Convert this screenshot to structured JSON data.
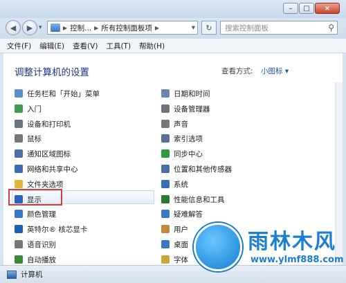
{
  "titlebar": {
    "minimize": "–",
    "maximize": "□",
    "close": "×"
  },
  "navbar": {
    "back": "◀",
    "forward": "▶",
    "history": "▾",
    "breadcrumb_root": "▶",
    "breadcrumb_1": "控制...",
    "sep": "▶",
    "breadcrumb_2": "所有控制面板项",
    "sep2": "▶",
    "address_dropdown": "▾",
    "refresh": "↻",
    "search_placeholder": "搜索控制面板",
    "search_icon": "⚲"
  },
  "menu": [
    "文件(F)",
    "编辑(E)",
    "查看(V)",
    "工具(T)",
    "帮助(H)"
  ],
  "header": {
    "title": "调整计算机的设置",
    "view_label": "查看方式:",
    "view_value": "小图标 ▾"
  },
  "left_items": [
    {
      "label": "任务栏和「开始」菜单",
      "icon": "taskbar-icon",
      "color": "#5b8fd0"
    },
    {
      "label": "入门",
      "icon": "getting-started-icon",
      "color": "#3c9b4c"
    },
    {
      "label": "设备和打印机",
      "icon": "printer-icon",
      "color": "#6a7480"
    },
    {
      "label": "鼠标",
      "icon": "mouse-icon",
      "color": "#777"
    },
    {
      "label": "通知区域图标",
      "icon": "notification-icon",
      "color": "#4a6fa6"
    },
    {
      "label": "网络和共享中心",
      "icon": "network-icon",
      "color": "#3d6db1"
    },
    {
      "label": "文件夹选项",
      "icon": "folder-icon",
      "color": "#e2b63b"
    },
    {
      "label": "显示",
      "icon": "display-icon",
      "color": "#2a62b8"
    },
    {
      "label": "颜色管理",
      "icon": "color-icon",
      "color": "#3a78c8"
    },
    {
      "label": "英特尔® 核芯显卡",
      "icon": "intel-icon",
      "color": "#1d5fb0"
    },
    {
      "label": "语音识别",
      "icon": "microphone-icon",
      "color": "#777"
    },
    {
      "label": "自动播放",
      "icon": "autoplay-icon",
      "color": "#3a8a3a"
    }
  ],
  "right_items": [
    {
      "label": "日期和时间",
      "icon": "clock-icon",
      "color": "#6b86b1"
    },
    {
      "label": "设备管理器",
      "icon": "device-manager-icon",
      "color": "#6a7480"
    },
    {
      "label": "声音",
      "icon": "speaker-icon",
      "color": "#777"
    },
    {
      "label": "索引选项",
      "icon": "index-icon",
      "color": "#5a6f95"
    },
    {
      "label": "同步中心",
      "icon": "sync-icon",
      "color": "#2e9b3a"
    },
    {
      "label": "位置和其他传感器",
      "icon": "location-icon",
      "color": "#4a6fa6"
    },
    {
      "label": "系统",
      "icon": "system-icon",
      "color": "#3d6db1"
    },
    {
      "label": "性能信息和工具",
      "icon": "performance-icon",
      "color": "#2a7a2a"
    },
    {
      "label": "疑难解答",
      "icon": "troubleshoot-icon",
      "color": "#3a78c8"
    },
    {
      "label": "用户",
      "icon": "user-icon",
      "color": "#c08a3a"
    },
    {
      "label": "桌面",
      "icon": "desktop-icon",
      "color": "#3a78c8"
    },
    {
      "label": "字体",
      "icon": "font-icon",
      "color": "#c8a83a"
    }
  ],
  "status": {
    "label": "计算机"
  },
  "watermark": {
    "title": "雨林木风",
    "url": "www.ylmf888.com"
  }
}
